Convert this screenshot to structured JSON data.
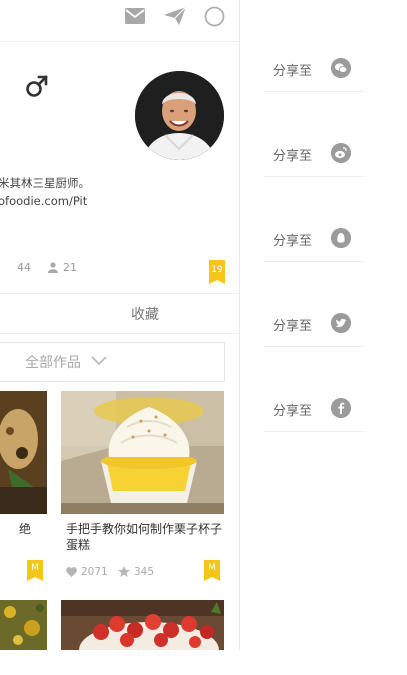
{
  "header": {
    "icons": [
      "mail-icon",
      "send-icon",
      "circle-icon"
    ]
  },
  "profile": {
    "gender_icon": "male-icon",
    "bio_line1": "米其林三星厨师。",
    "bio_line2": "ofoodie.com/Pit",
    "stat1_value": "44",
    "stat2_value": "21",
    "badge_count": "19"
  },
  "tabs": {
    "favorites": "收藏"
  },
  "filter": {
    "label": "全部作品"
  },
  "works": [
    {
      "title_fragment": "绝",
      "badge": "M"
    },
    {
      "title": "手把手教你如何制作栗子杯子蛋糕",
      "likes": "2071",
      "favorites": "345",
      "badge": "M"
    }
  ],
  "share": {
    "items": [
      {
        "label": "分享至",
        "icon": "wechat-icon"
      },
      {
        "label": "分享至",
        "icon": "weibo-icon"
      },
      {
        "label": "分享至",
        "icon": "qq-icon"
      },
      {
        "label": "分享至",
        "icon": "twitter-icon"
      },
      {
        "label": "分享至",
        "icon": "facebook-icon"
      }
    ]
  },
  "colors": {
    "accent": "#f5c518",
    "icon_gray": "#9b9b9b"
  }
}
